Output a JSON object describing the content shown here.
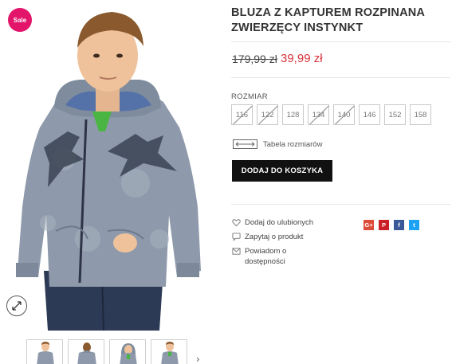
{
  "badge": {
    "label": "Sale",
    "color": "#e2156b"
  },
  "product": {
    "title": "BLUZA Z KAPTUREM ROZPINANA ZWIERZĘCY INSTYNKT",
    "price_old": "179,99 zł",
    "price_new": "39,99 zł",
    "price_new_color": "#d9323a"
  },
  "sizes": {
    "label": "ROZMIAR",
    "options": [
      {
        "label": "116",
        "available": false
      },
      {
        "label": "122",
        "available": false
      },
      {
        "label": "128",
        "available": true
      },
      {
        "label": "134",
        "available": false
      },
      {
        "label": "140",
        "available": false
      },
      {
        "label": "146",
        "available": true
      },
      {
        "label": "152",
        "available": true
      },
      {
        "label": "158",
        "available": true
      }
    ],
    "size_table_label": "Tabela rozmiarów"
  },
  "cart": {
    "add_label": "DODAJ DO KOSZYKA"
  },
  "actions": {
    "wishlist_label": "Dodaj do ulubionych",
    "ask_label": "Zapytaj o produkt",
    "notify_label": "Powiadom o dostępności"
  },
  "share": [
    {
      "icon": "google-plus-icon",
      "glyph": "G+",
      "color": "#dd4b39"
    },
    {
      "icon": "pinterest-icon",
      "glyph": "P",
      "color": "#cb2027"
    },
    {
      "icon": "facebook-icon",
      "glyph": "f",
      "color": "#3b5998"
    },
    {
      "icon": "twitter-icon",
      "glyph": "t",
      "color": "#1da1f2"
    }
  ],
  "gallery": {
    "thumb_count": 4,
    "zoom_icon": "expand-icon",
    "next_icon": "chevron-right-icon"
  }
}
